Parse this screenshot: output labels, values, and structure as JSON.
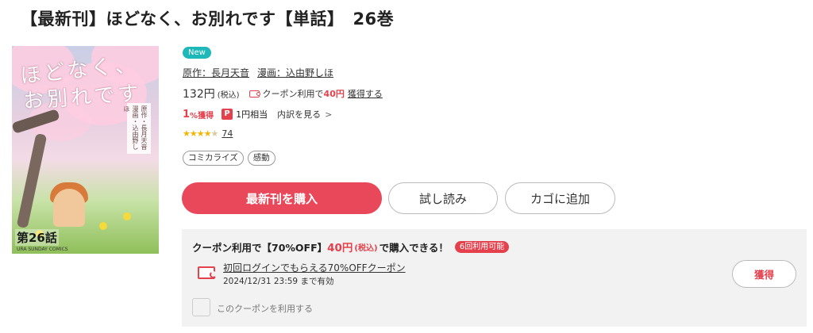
{
  "product": {
    "title": "【最新刊】ほどなく、お別れです【単話】　26巻",
    "badge": "New",
    "author_label": "原作：長月天音",
    "artist_label": "漫画：込由野しほ",
    "price": "132円",
    "tax": "(税込)",
    "coupon_text": "クーポン利用で",
    "coupon_price": "40円",
    "get_link": "獲得する",
    "points_percent": "1",
    "points_label": "%獲得",
    "pay_icon": "P",
    "points_equiv": "1円相当",
    "breakdown": "内訳を見る",
    "breakdown_chevron": ">",
    "rating_value": 4.5,
    "rating_count": "74",
    "tags": [
      "コミカライズ",
      "感動"
    ]
  },
  "cover": {
    "title_line1": "ほどなく、",
    "title_line2": "お別れです",
    "credits": "原作・長月天音 漫画・込由野しほ",
    "episode": "第26話",
    "brand": "URA SUNDAY COMICS"
  },
  "actions": {
    "buy_label": "最新刊を購入",
    "trial_label": "試し読み",
    "cart_label": "カゴに追加"
  },
  "coupon": {
    "head_prefix": "クーポン利用で【70%OFF】",
    "head_price": "40円",
    "head_tax": "(税込)",
    "head_suffix": "で購入できる！",
    "availability": "6回利用可能",
    "name": "初回ログインでもらえる70%OFFクーポン",
    "expiry": "2024/12/31 23:59 まで有効",
    "get_button": "獲得",
    "use_label": "このクーポンを利用する",
    "use_checked": false
  },
  "colors": {
    "accent": "#e9485a",
    "coupon_red": "#e4414d",
    "new_badge": "#1fb8b8",
    "star": "#f5b400"
  }
}
